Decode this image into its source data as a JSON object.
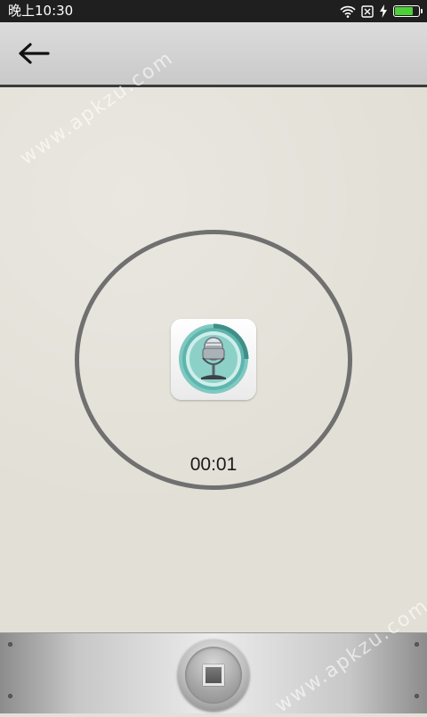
{
  "status_bar": {
    "time": "晚上10:30",
    "battery_level": 0.8,
    "battery_color": "#4cd137",
    "icons": [
      "wifi-icon",
      "sim-icon",
      "charging-bolt-icon",
      "battery-icon"
    ]
  },
  "app_bar": {
    "back_icon": "arrow-left-icon"
  },
  "recorder": {
    "timer": "00:01",
    "center_icon": "microphone-app-icon",
    "ring_color": "#707070"
  },
  "controls": {
    "stop_icon": "stop-square-icon"
  },
  "watermarks": [
    "www.apkzu.com",
    "www.apkzu.com"
  ]
}
